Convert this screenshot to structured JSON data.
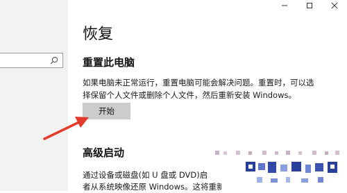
{
  "window": {
    "caption_buttons": [
      "minimize",
      "maximize",
      "close"
    ]
  },
  "search": {
    "icon": "search-icon",
    "value": ""
  },
  "main": {
    "title": "恢复",
    "reset": {
      "heading": "重置此电脑",
      "description_line1": "如果电脑未正常运行，重置电脑可能会解决问题。重置时，可以选",
      "description_line2": "择保留个人文件或删除个人文件，然后重新安装 Windows。",
      "button_label": "开始"
    },
    "advanced": {
      "heading": "高级启动",
      "description_line1": "通过设备或磁盘(如 U 盘或 DVD)启",
      "description_line2": "者从系统映像还原 Windows。这将重新启动电"
    }
  },
  "annotation": {
    "arrow_color": "#e23b2b"
  },
  "colors": {
    "sidebar_bg": "#f2f2f2",
    "button_bg": "#cccccc"
  }
}
